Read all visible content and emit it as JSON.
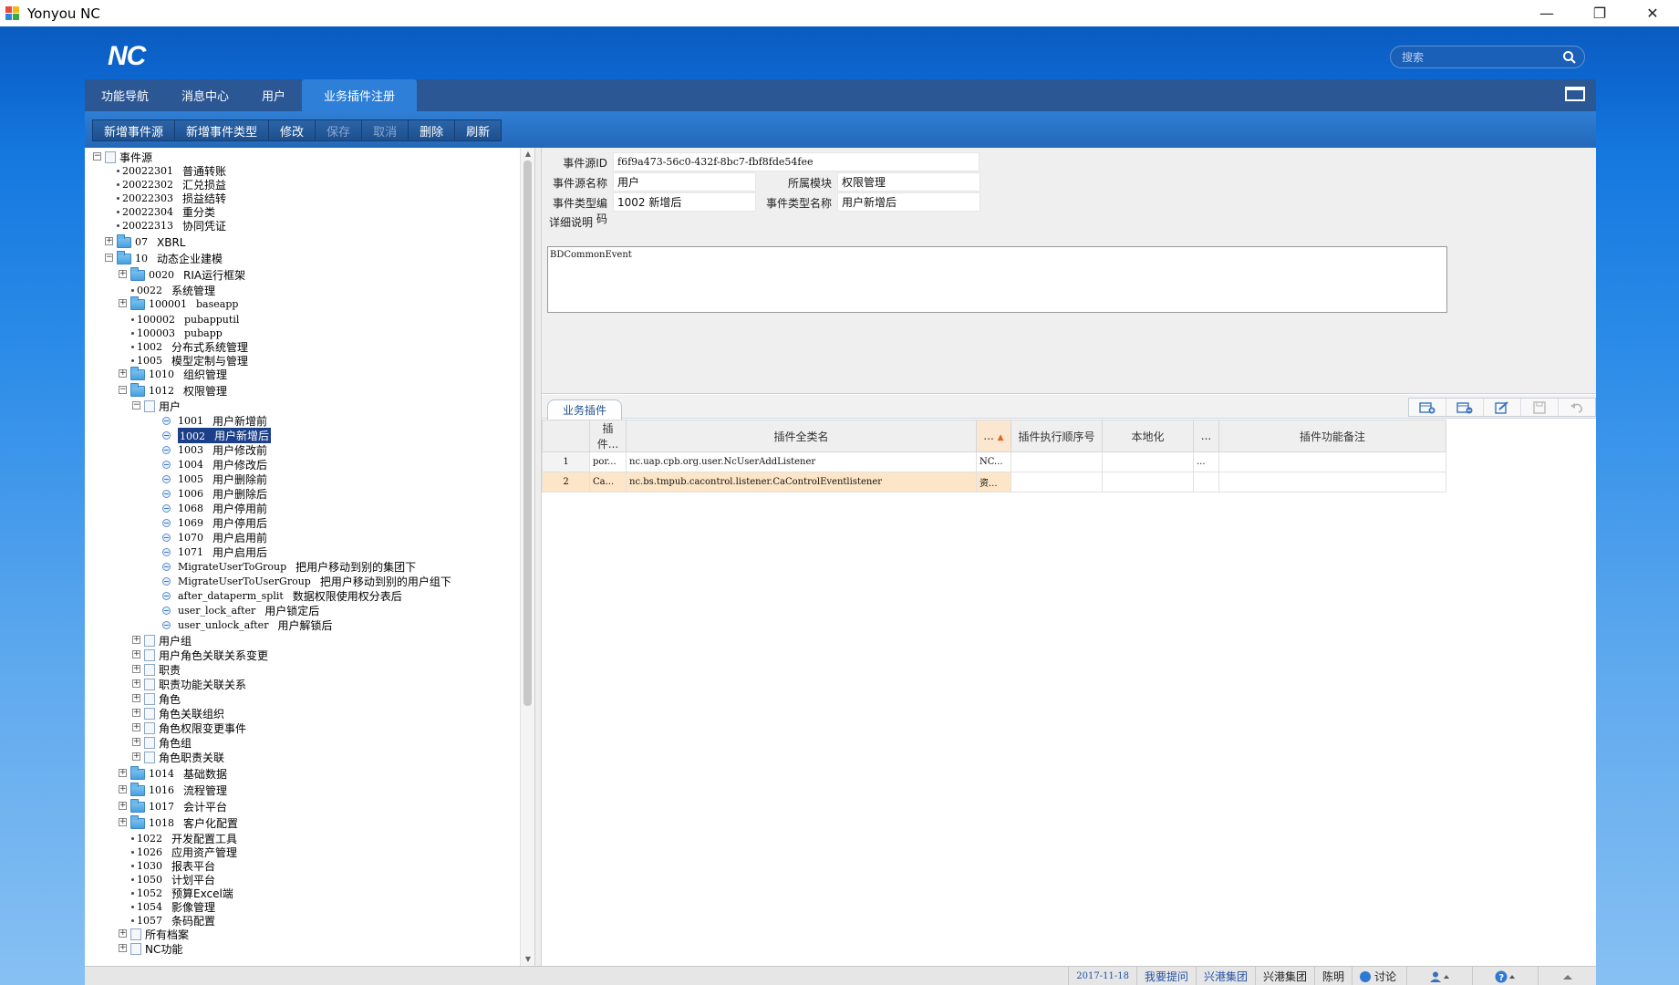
{
  "window": {
    "title": "Yonyou NC",
    "min": "—",
    "restore": "❐",
    "close": "✕"
  },
  "header": {
    "logo": "NC",
    "search_placeholder": "搜索"
  },
  "tabs": [
    {
      "label": "功能导航"
    },
    {
      "label": "消息中心"
    },
    {
      "label": "用户"
    },
    {
      "label": "业务插件注册"
    }
  ],
  "toolbar": {
    "add_source": "新增事件源",
    "add_type": "新增事件类型",
    "modify": "修改",
    "save": "保存",
    "cancel": "取消",
    "delete": "删除",
    "refresh": "刷新"
  },
  "tree": {
    "root": "事件源",
    "n20022301": {
      "code": "20022301",
      "name": "普通转账"
    },
    "n20022302": {
      "code": "20022302",
      "name": "汇兑损益"
    },
    "n20022303": {
      "code": "20022303",
      "name": "损益结转"
    },
    "n20022304": {
      "code": "20022304",
      "name": "重分类"
    },
    "n20022313": {
      "code": "20022313",
      "name": "协同凭证"
    },
    "n07": {
      "code": "07",
      "name": "XBRL"
    },
    "n10": {
      "code": "10",
      "name": "动态企业建模"
    },
    "n0020": {
      "code": "0020",
      "name": "RIA运行框架"
    },
    "n0022": {
      "code": "0022",
      "name": "系统管理"
    },
    "n100001": {
      "code": "100001",
      "name": "baseapp"
    },
    "n100002": {
      "code": "100002",
      "name": "pubapputil"
    },
    "n100003": {
      "code": "100003",
      "name": "pubapp"
    },
    "n1002": {
      "code": "1002",
      "name": "分布式系统管理"
    },
    "n1005": {
      "code": "1005",
      "name": "模型定制与管理"
    },
    "n1010": {
      "code": "1010",
      "name": "组织管理"
    },
    "n1012": {
      "code": "1012",
      "name": "权限管理"
    },
    "user": "用户",
    "e1001": {
      "code": "1001",
      "name": "用户新增前"
    },
    "e1002": {
      "code": "1002",
      "name": "用户新增后"
    },
    "e1003": {
      "code": "1003",
      "name": "用户修改前"
    },
    "e1004": {
      "code": "1004",
      "name": "用户修改后"
    },
    "e1005": {
      "code": "1005",
      "name": "用户删除前"
    },
    "e1006": {
      "code": "1006",
      "name": "用户删除后"
    },
    "e1068": {
      "code": "1068",
      "name": "用户停用前"
    },
    "e1069": {
      "code": "1069",
      "name": "用户停用后"
    },
    "e1070": {
      "code": "1070",
      "name": "用户启用前"
    },
    "e1071": {
      "code": "1071",
      "name": "用户启用后"
    },
    "eMig": {
      "code": "MigrateUserToGroup",
      "name": "把用户移动到别的集团下"
    },
    "eMigUG": {
      "code": "MigrateUserToUserGroup",
      "name": "把用户移动到别的用户组下"
    },
    "eDp": {
      "code": "after_dataperm_split",
      "name": "数据权限使用权分表后"
    },
    "eLock": {
      "code": "user_lock_after",
      "name": "用户锁定后"
    },
    "eUnlock": {
      "code": "user_unlock_after",
      "name": "用户解锁后"
    },
    "usergroup": "用户组",
    "userrole_rel": "用户角色关联关系变更",
    "duty": "职责",
    "duty_func": "职责功能关联关系",
    "role": "角色",
    "role_org": "角色关联组织",
    "role_perm": "角色权限变更事件",
    "rolegroup": "角色组",
    "role_duty": "角色职责关联",
    "n1014": {
      "code": "1014",
      "name": "基础数据"
    },
    "n1016": {
      "code": "1016",
      "name": "流程管理"
    },
    "n1017": {
      "code": "1017",
      "name": "会计平台"
    },
    "n1018": {
      "code": "1018",
      "name": "客户化配置"
    },
    "n1022": {
      "code": "1022",
      "name": "开发配置工具"
    },
    "n1026": {
      "code": "1026",
      "name": "应用资产管理"
    },
    "n1030": {
      "code": "1030",
      "name": "报表平台"
    },
    "n1050": {
      "code": "1050",
      "name": "计划平台"
    },
    "n1052": {
      "code": "1052",
      "name": "预算Excel端"
    },
    "n1054": {
      "code": "1054",
      "name": "影像管理"
    },
    "n1057": {
      "code": "1057",
      "name": "条码配置"
    },
    "all_archives": "所有档案",
    "nc_func": "NC功能"
  },
  "form": {
    "source_id_label": "事件源ID",
    "source_id": "f6f9a473-56c0-432f-8bc7-fbf8fde54fee",
    "source_name_label": "事件源名称",
    "source_name": "用户",
    "module_label": "所属模块",
    "module": "权限管理",
    "type_code_label": "事件类型编码",
    "type_code": "1002 新增后",
    "type_name_label": "事件类型名称",
    "type_name": "用户新增后",
    "desc_label": "详细说明",
    "desc": "BDCommonEvent"
  },
  "plugin_tab": "业务插件",
  "grid": {
    "headers": {
      "c1": "插件...",
      "c2": "插件全类名",
      "c3": "...",
      "c4": "插件执行顺序号",
      "c5": "本地化",
      "c6": "...",
      "c7": "插件功能备注"
    },
    "rows": [
      {
        "no": "1",
        "c1": "por...",
        "c2": "nc.uap.cpb.org.user.NcUserAddListener",
        "c3": "NC...",
        "c4": "",
        "c5": "",
        "c6": "...",
        "c7": ""
      },
      {
        "no": "2",
        "c1": "Ca...",
        "c2": "nc.bs.tmpub.cacontrol.listener.CaControlEventlistener",
        "c3": "资...",
        "c4": "",
        "c5": "",
        "c6": "",
        "c7": ""
      }
    ]
  },
  "status": {
    "date": "2017-11-18",
    "ask": "我要提问",
    "group_link": "兴港集团",
    "group": "兴港集团",
    "user": "陈明",
    "discuss": "讨论"
  },
  "colors": {
    "accent": "#0d67d0",
    "selection": "#1c3f8a",
    "row_highlight": "#fde6c8"
  }
}
